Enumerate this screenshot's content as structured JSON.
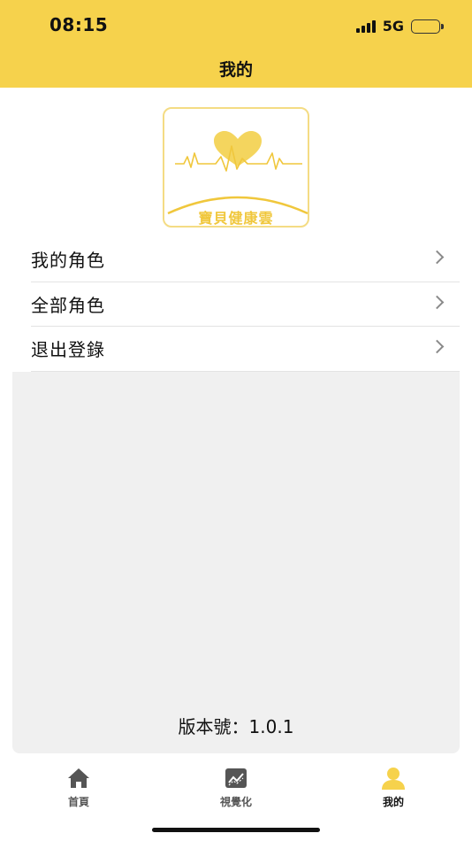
{
  "status_bar": {
    "time": "08:15",
    "network": "5G",
    "signal_bars": 4
  },
  "header": {
    "title": "我的",
    "background_color": "#f6d24c"
  },
  "logo": {
    "text": "寶貝健康雲",
    "icon": "heart-pulse-icon",
    "color": "#f0c73c"
  },
  "menu": {
    "items": [
      {
        "label": "我的角色",
        "icon": "chevron-right-icon"
      },
      {
        "label": "全部角色",
        "icon": "chevron-right-icon"
      },
      {
        "label": "退出登錄",
        "icon": "chevron-right-icon"
      }
    ]
  },
  "footer": {
    "version": "版本號：1.0.1"
  },
  "tabbar": {
    "tabs": [
      {
        "label": "首頁",
        "icon": "home-icon",
        "active": false
      },
      {
        "label": "視覺化",
        "icon": "chart-icon",
        "active": false
      },
      {
        "label": "我的",
        "icon": "user-icon",
        "active": true
      }
    ],
    "active_color": "#f6d24c",
    "inactive_color": "#555555"
  }
}
